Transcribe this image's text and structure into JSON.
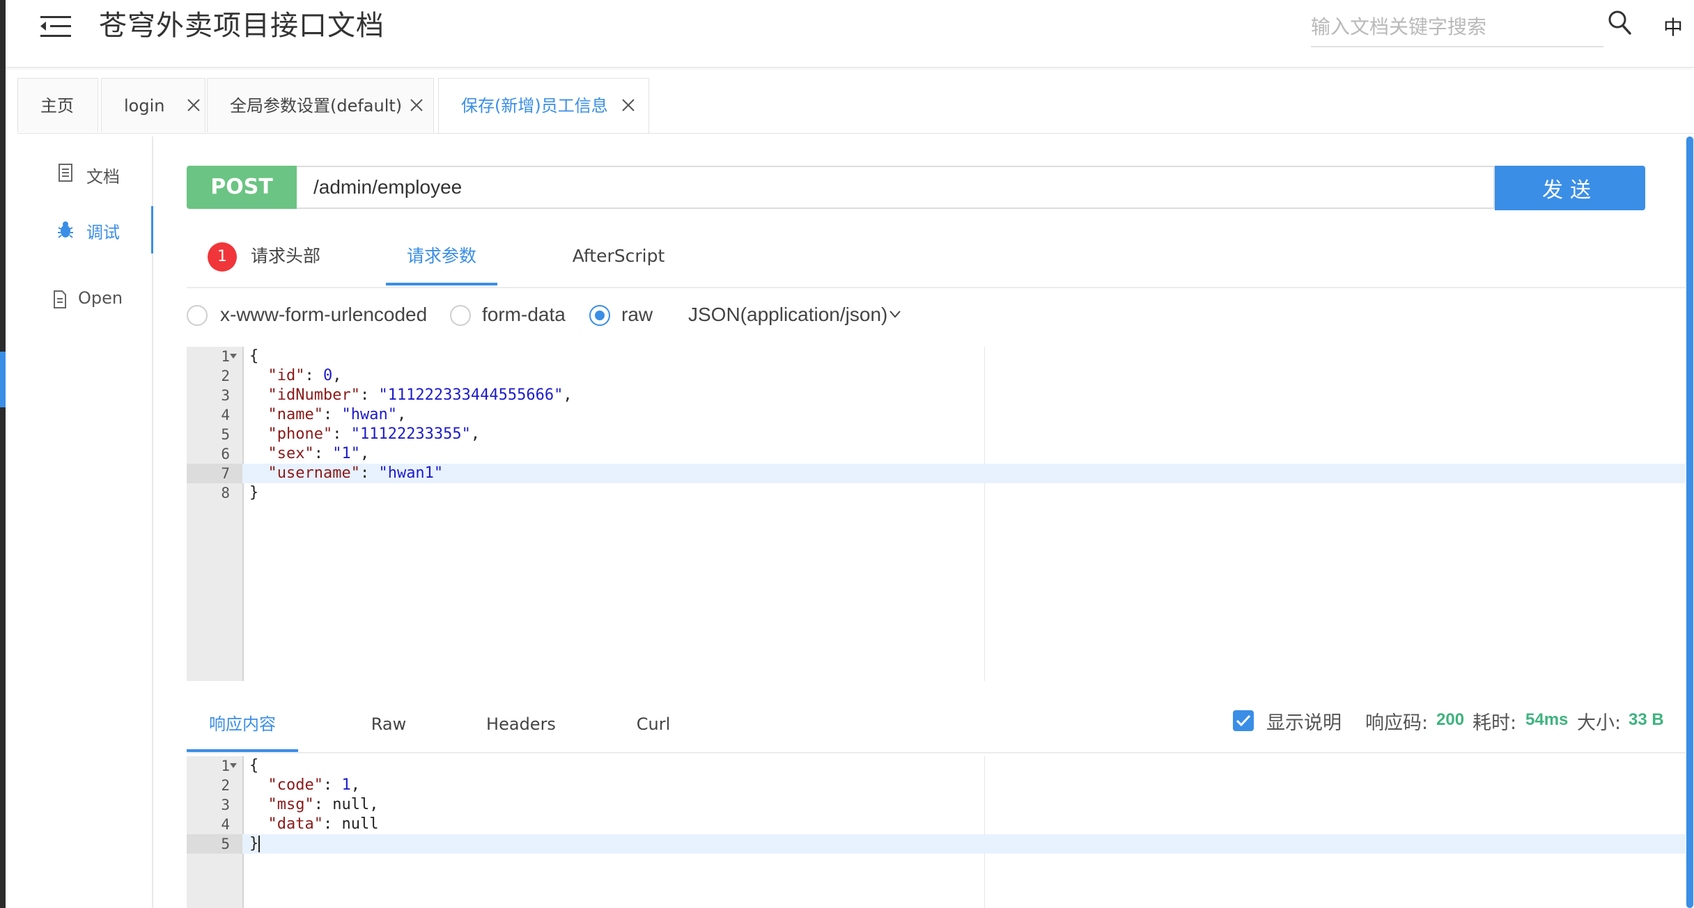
{
  "app": {
    "title": "苍穹外卖项目接口文档"
  },
  "search": {
    "placeholder": "输入文档关键字搜索"
  },
  "lang": "中",
  "tabs": [
    {
      "label": "主页"
    },
    {
      "label": "login"
    },
    {
      "label": "全局参数设置(default)"
    },
    {
      "label": "保存(新增)员工信息"
    }
  ],
  "sidebar": {
    "items": [
      {
        "label": "文档"
      },
      {
        "label": "调试"
      },
      {
        "label": "Open"
      }
    ]
  },
  "request": {
    "method": "POST",
    "url": "/admin/employee",
    "send_label": "发送"
  },
  "req_tabs": {
    "badge": "1",
    "headers": "请求头部",
    "params": "请求参数",
    "after": "AfterScript"
  },
  "body_types": {
    "urlencoded": "x-www-form-urlencoded",
    "formdata": "form-data",
    "raw": "raw",
    "content_type": "JSON(application/json)"
  },
  "request_body": {
    "line_numbers": [
      "1",
      "2",
      "3",
      "4",
      "5",
      "6",
      "7",
      "8"
    ],
    "open": "{",
    "close": "}",
    "fields": [
      {
        "key": "\"id\"",
        "value": "0",
        "sep": ","
      },
      {
        "key": "\"idNumber\"",
        "value": "\"111222333444555666\"",
        "sep": ","
      },
      {
        "key": "\"name\"",
        "value": "\"hwan\"",
        "sep": ","
      },
      {
        "key": "\"phone\"",
        "value": "\"11122233355\"",
        "sep": ","
      },
      {
        "key": "\"sex\"",
        "value": "\"1\"",
        "sep": ","
      },
      {
        "key": "\"username\"",
        "value": "\"hwan1\"",
        "sep": ""
      }
    ]
  },
  "resp_tabs": {
    "content": "响应内容",
    "raw": "Raw",
    "headers": "Headers",
    "curl": "Curl"
  },
  "resp_meta": {
    "show_desc": "显示说明",
    "code_label": "响应码:",
    "code_value": "200",
    "time_label": "耗时:",
    "time_value": "54ms",
    "size_label": "大小:",
    "size_value": "33 B"
  },
  "response_body": {
    "line_numbers": [
      "1",
      "2",
      "3",
      "4",
      "5"
    ],
    "open": "{",
    "close": "}",
    "fields": [
      {
        "key": "\"code\"",
        "value": "1",
        "sep": ","
      },
      {
        "key": "\"msg\"",
        "value": "null",
        "sep": ","
      },
      {
        "key": "\"data\"",
        "value": "null",
        "sep": ""
      }
    ]
  },
  "colors": {
    "accent": "#3a8ee6",
    "post": "#6bc483",
    "badge": "#f0363a",
    "success": "#3fb37f"
  }
}
